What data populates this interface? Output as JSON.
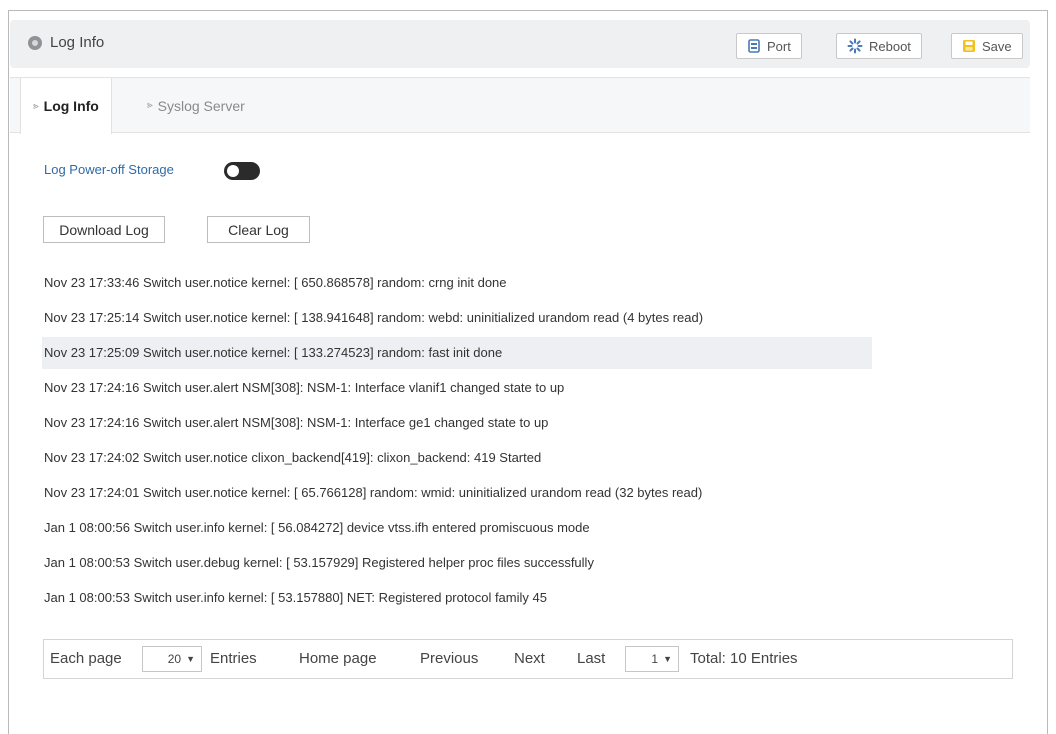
{
  "header": {
    "title": "Log Info",
    "buttons": {
      "port": "Port",
      "reboot": "Reboot",
      "save": "Save"
    }
  },
  "tabs": [
    {
      "label": "Log Info",
      "active": true
    },
    {
      "label": "Syslog Server",
      "active": false
    }
  ],
  "settings": {
    "power_off_label": "Log Power-off Storage",
    "power_off_enabled": false
  },
  "actions": {
    "download": "Download Log",
    "clear": "Clear Log"
  },
  "logs": [
    "Nov 23 17:33:46 Switch user.notice kernel: [ 650.868578] random: crng init done",
    "Nov 23 17:25:14 Switch user.notice kernel: [ 138.941648] random: webd: uninitialized urandom read (4 bytes read)",
    "Nov 23 17:25:09 Switch user.notice kernel: [ 133.274523] random: fast init done",
    "Nov 23 17:24:16 Switch user.alert NSM[308]: NSM-1: Interface vlanif1 changed state to up",
    "Nov 23 17:24:16 Switch user.alert NSM[308]: NSM-1: Interface ge1 changed state to up",
    "Nov 23 17:24:02 Switch user.notice clixon_backend[419]: clixon_backend: 419 Started",
    "Nov 23 17:24:01 Switch user.notice kernel: [ 65.766128] random: wmid: uninitialized urandom read (32 bytes read)",
    "Jan 1 08:00:56 Switch user.info kernel: [ 56.084272] device vtss.ifh entered promiscuous mode",
    "Jan 1 08:00:53 Switch user.debug kernel: [ 53.157929] Registered helper proc files successfully",
    "Jan 1 08:00:53 Switch user.info kernel: [ 53.157880] NET: Registered protocol family 45"
  ],
  "highlighted_row": 2,
  "pager": {
    "each_page": "Each page",
    "page_size": "20",
    "entries": "Entries",
    "home": "Home page",
    "previous": "Previous",
    "next": "Next",
    "last": "Last",
    "current_page": "1",
    "total": "Total: 10 Entries"
  },
  "colors": {
    "accent_link": "#2f6aa8",
    "save_icon": "#f2c11c",
    "port_icon": "#4a78b5",
    "reboot_icon": "#4a78b5"
  }
}
